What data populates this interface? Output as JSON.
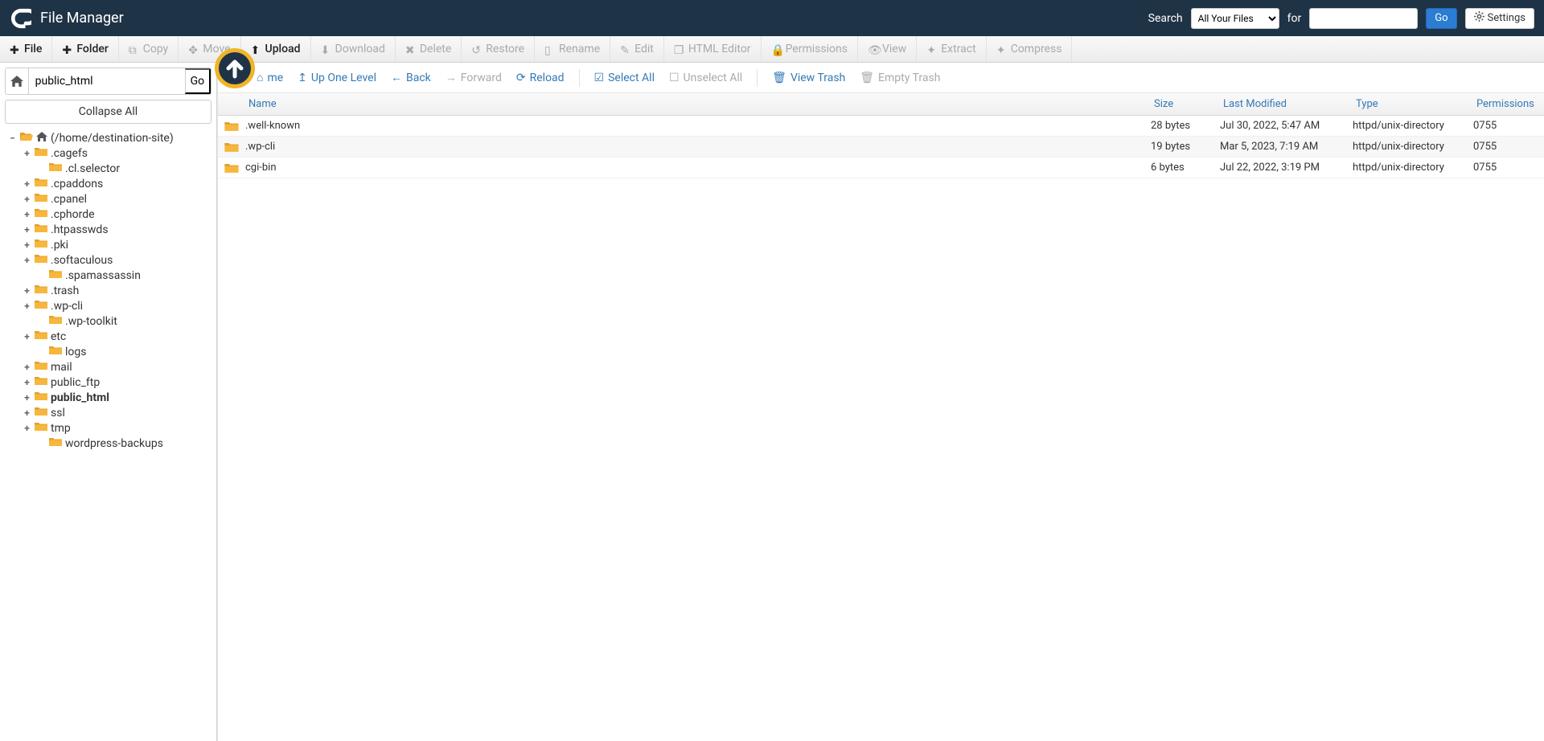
{
  "header": {
    "appTitle": "File Manager",
    "searchLabel": "Search",
    "searchSelected": "All Your Files",
    "forLabel": "for",
    "goLabel": "Go",
    "settingsLabel": "Settings"
  },
  "toolbar": [
    {
      "icon": "plus",
      "label": "File",
      "state": "active"
    },
    {
      "icon": "plus",
      "label": "Folder",
      "state": "active"
    },
    {
      "icon": "copy",
      "label": "Copy",
      "state": "disabled"
    },
    {
      "icon": "move",
      "label": "Move",
      "state": "disabled"
    },
    {
      "icon": "upload",
      "label": "Upload",
      "state": "active"
    },
    {
      "icon": "download",
      "label": "Download",
      "state": "disabled"
    },
    {
      "icon": "delete",
      "label": "Delete",
      "state": "disabled"
    },
    {
      "icon": "restore",
      "label": "Restore",
      "state": "disabled"
    },
    {
      "icon": "rename",
      "label": "Rename",
      "state": "disabled"
    },
    {
      "icon": "edit",
      "label": "Edit",
      "state": "disabled"
    },
    {
      "icon": "html",
      "label": "HTML Editor",
      "state": "disabled"
    },
    {
      "icon": "perm",
      "label": "Permissions",
      "state": "disabled"
    },
    {
      "icon": "view",
      "label": "View",
      "state": "disabled"
    },
    {
      "icon": "extract",
      "label": "Extract",
      "state": "disabled"
    },
    {
      "icon": "compress",
      "label": "Compress",
      "state": "disabled"
    }
  ],
  "sidebar": {
    "pathValue": "public_html",
    "goLabel": "Go",
    "collapseLabel": "Collapse All",
    "tree": [
      {
        "depth": 0,
        "expander": "−",
        "open": true,
        "home": true,
        "label": "(/home/destination-site)"
      },
      {
        "depth": 1,
        "expander": "+",
        "label": ".cagefs"
      },
      {
        "depth": 2,
        "expander": "",
        "label": ".cl.selector"
      },
      {
        "depth": 1,
        "expander": "+",
        "label": ".cpaddons"
      },
      {
        "depth": 1,
        "expander": "+",
        "label": ".cpanel"
      },
      {
        "depth": 1,
        "expander": "+",
        "label": ".cphorde"
      },
      {
        "depth": 1,
        "expander": "+",
        "label": ".htpasswds"
      },
      {
        "depth": 1,
        "expander": "+",
        "label": ".pki"
      },
      {
        "depth": 1,
        "expander": "+",
        "label": ".softaculous"
      },
      {
        "depth": 2,
        "expander": "",
        "label": ".spamassassin"
      },
      {
        "depth": 1,
        "expander": "+",
        "label": ".trash"
      },
      {
        "depth": 1,
        "expander": "+",
        "label": ".wp-cli"
      },
      {
        "depth": 2,
        "expander": "",
        "label": ".wp-toolkit"
      },
      {
        "depth": 1,
        "expander": "+",
        "label": "etc"
      },
      {
        "depth": 2,
        "expander": "",
        "label": "logs"
      },
      {
        "depth": 1,
        "expander": "+",
        "label": "mail"
      },
      {
        "depth": 1,
        "expander": "+",
        "label": "public_ftp"
      },
      {
        "depth": 1,
        "expander": "+",
        "label": "public_html",
        "bold": true
      },
      {
        "depth": 1,
        "expander": "+",
        "label": "ssl"
      },
      {
        "depth": 1,
        "expander": "+",
        "label": "tmp"
      },
      {
        "depth": 2,
        "expander": "",
        "label": "wordpress-backups"
      }
    ]
  },
  "actions": {
    "home": "me",
    "upOne": "Up One Level",
    "back": "Back",
    "forward": "Forward",
    "reload": "Reload",
    "selectAll": "Select All",
    "unselectAll": "Unselect All",
    "viewTrash": "View Trash",
    "emptyTrash": "Empty Trash"
  },
  "columns": {
    "name": "Name",
    "size": "Size",
    "modified": "Last Modified",
    "type": "Type",
    "perm": "Permissions"
  },
  "rows": [
    {
      "name": ".well-known",
      "size": "28 bytes",
      "modified": "Jul 30, 2022, 5:47 AM",
      "type": "httpd/unix-directory",
      "perm": "0755"
    },
    {
      "name": ".wp-cli",
      "size": "19 bytes",
      "modified": "Mar 5, 2023, 7:19 AM",
      "type": "httpd/unix-directory",
      "perm": "0755"
    },
    {
      "name": "cgi-bin",
      "size": "6 bytes",
      "modified": "Jul 22, 2022, 3:19 PM",
      "type": "httpd/unix-directory",
      "perm": "0755"
    }
  ]
}
